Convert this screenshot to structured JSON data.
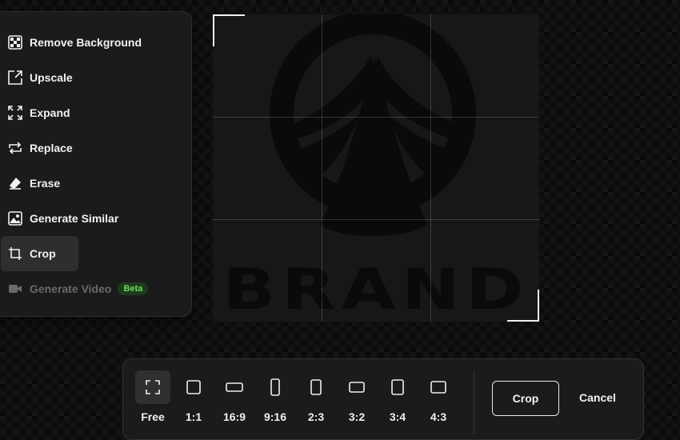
{
  "tools": [
    {
      "label": "Remove Background",
      "icon": "checkerboard-icon",
      "state": "normal"
    },
    {
      "label": "Upscale",
      "icon": "upscale-icon",
      "state": "normal"
    },
    {
      "label": "Expand",
      "icon": "expand-icon",
      "state": "normal"
    },
    {
      "label": "Replace",
      "icon": "replace-icon",
      "state": "normal"
    },
    {
      "label": "Erase",
      "icon": "eraser-icon",
      "state": "normal"
    },
    {
      "label": "Generate Similar",
      "icon": "image-icon",
      "state": "normal"
    },
    {
      "label": "Crop",
      "icon": "crop-icon",
      "state": "active"
    },
    {
      "label": "Generate Video",
      "icon": "video-camera-icon",
      "state": "disabled",
      "badge": "Beta"
    }
  ],
  "canvas": {
    "logo_text": "BRAND",
    "grid": "rule-of-thirds"
  },
  "crop_toolbar": {
    "ratios": [
      {
        "label": "Free",
        "icon": "free-crop-icon",
        "selected": true
      },
      {
        "label": "1:1",
        "icon": "ratio-1-1-icon",
        "selected": false
      },
      {
        "label": "16:9",
        "icon": "ratio-16-9-icon",
        "selected": false
      },
      {
        "label": "9:16",
        "icon": "ratio-9-16-icon",
        "selected": false
      },
      {
        "label": "2:3",
        "icon": "ratio-2-3-icon",
        "selected": false
      },
      {
        "label": "3:2",
        "icon": "ratio-3-2-icon",
        "selected": false
      },
      {
        "label": "3:4",
        "icon": "ratio-3-4-icon",
        "selected": false
      },
      {
        "label": "4:3",
        "icon": "ratio-4-3-icon",
        "selected": false
      }
    ],
    "crop_label": "Crop",
    "cancel_label": "Cancel"
  },
  "colors": {
    "background": "#0c0c0c",
    "panel": "#1b1b1b",
    "active_item": "#2e2e2e",
    "beta_text": "#6cdb5a",
    "beta_bg": "#1f3a1f"
  }
}
